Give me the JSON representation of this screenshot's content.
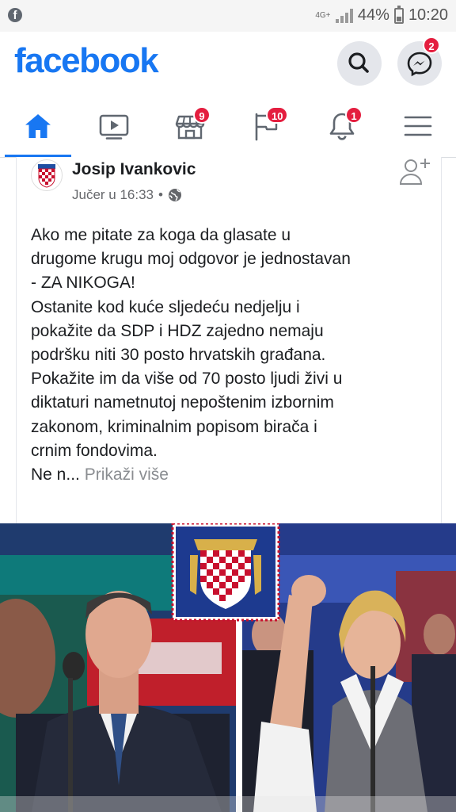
{
  "status_bar": {
    "network": "4G+",
    "battery": "44%",
    "battery_level": 0.44,
    "time": "10:20"
  },
  "header": {
    "logo": "facebook",
    "search_icon": "search-icon",
    "messenger_icon": "messenger-icon",
    "messenger_badge": "2"
  },
  "nav": {
    "tabs": [
      {
        "icon": "home-icon",
        "badge": "",
        "active": true
      },
      {
        "icon": "watch-icon",
        "badge": ""
      },
      {
        "icon": "marketplace-icon",
        "badge": "9"
      },
      {
        "icon": "flag-icon",
        "badge": "10"
      },
      {
        "icon": "bell-icon",
        "badge": "1"
      },
      {
        "icon": "menu-icon",
        "badge": ""
      }
    ]
  },
  "post": {
    "author": "Josip Ivankovic",
    "timestamp": "Jučer u 16:33",
    "separator": "•",
    "privacy_icon": "globe-icon",
    "lines": [
      "Ako me pitate za koga da glasate u",
      "drugome krugu moj odgovor je jednostavan",
      "- ZA NIKOGA!",
      "Ostanite kod kuće sljedeću nedjelju i",
      "pokažite da SDP i HDZ zajedno nemaju",
      "podršku niti 30 posto hrvatskih građana.",
      "Pokažite im da više od 70 posto ljudi živi u",
      "diktaturi nametnutoj nepoštenim izbornim",
      "zakonom, kriminalnim popisom birača i",
      "crnim fondovima."
    ],
    "truncated": "Ne n...",
    "see_more": "Prikaži više"
  },
  "colors": {
    "brand": "#1877f2",
    "badge": "#e41e3f",
    "text": "#1c1e21",
    "muted": "#65676b"
  }
}
